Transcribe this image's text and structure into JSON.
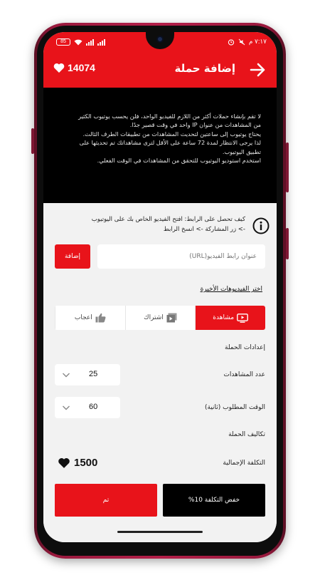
{
  "status_bar": {
    "battery": "85",
    "time": "٧:١٧ م"
  },
  "header": {
    "title": "إضافة حملة",
    "balance": "14074"
  },
  "notice": {
    "lines": [
      "لا تقم بإنشاء حملات أكثر من اللازم للفيديو الواحد، فلن يحسب يوتيوب الكثير",
      "من المشاهدات من عنوان IP واحد في وقت قصير جدًا.",
      "يحتاج يوتيوب إلى ساعتين لتحديث المشاهدات من تطبيقات الطرف الثالث.",
      "لذا يرجى الانتظار لمدة 72 ساعة على الأقل لترى مشاهداتك تم تحديثها على",
      "تطبيق اليوتيوب.",
      "استخدم استوديو اليوتيوب للتحقق من المشاهدات في الوقت الفعلي."
    ]
  },
  "howto": {
    "line1": "كيف تحصل على الرابط: افتح الفيديو الخاص بك على اليوتيوب",
    "line2": "-> زر المشاركة -> انسخ الرابط"
  },
  "url": {
    "placeholder": "عنوان رابط الفيديو(URL)",
    "add_label": "إضافة"
  },
  "recent_videos_label": "اختر الفيديوهات الأخيرة",
  "tabs": [
    {
      "label": "مشاهدة",
      "icon": "tv-play-icon",
      "active": true
    },
    {
      "label": "اشتراك",
      "icon": "subscribe-icon",
      "active": false
    },
    {
      "label": "اعجاب",
      "icon": "thumb-up-icon",
      "active": false
    }
  ],
  "campaign_settings": {
    "title": "إعدادات الحملة",
    "views_label": "عدد المشاهدات",
    "views_value": "25",
    "time_label": "الوقت المطلوب (ثانية)",
    "time_value": "60"
  },
  "costs": {
    "title": "تكاليف الحملة",
    "total_label": "التكلفة الإجمالية",
    "total_value": "1500"
  },
  "actions": {
    "done_label": "تم",
    "discount_label": "خفض التكلفة 10%"
  },
  "colors": {
    "accent": "#e8131a",
    "notice_bg": "#000000",
    "content_bg": "#f2f2f2"
  }
}
